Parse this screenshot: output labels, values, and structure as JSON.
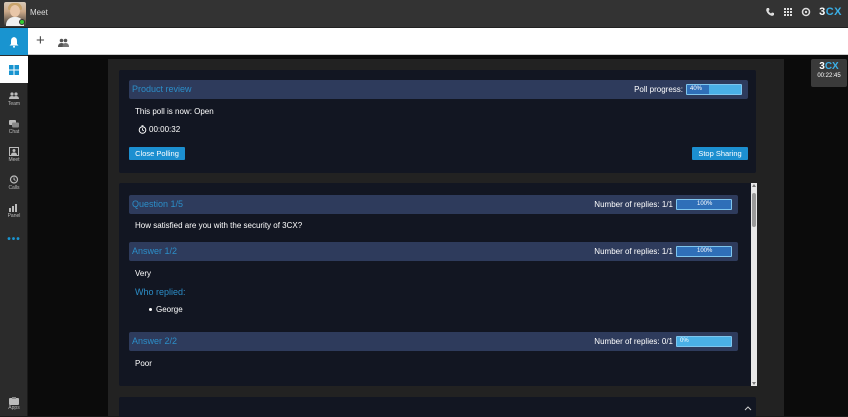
{
  "window": {
    "title": "Meet"
  },
  "brand": {
    "logo_prefix": "3",
    "logo_suffix": "CX",
    "accent": "#1994d0"
  },
  "sidebar": {
    "items": [
      {
        "label": "Team",
        "icon": "team-icon"
      },
      {
        "label": "Chat",
        "icon": "chat-icon"
      },
      {
        "label": "Meet",
        "icon": "meet-icon"
      },
      {
        "label": "Calls",
        "icon": "calls-icon"
      },
      {
        "label": "Panel",
        "icon": "panel-icon"
      }
    ],
    "more": "•••",
    "apps_label": "Apps"
  },
  "poll": {
    "title": "Product review",
    "progress_label": "Poll progress:",
    "progress_value": "40%",
    "progress_fraction": 0.4,
    "status_text": "This poll is now: Open",
    "timer": "00:00:32",
    "close_button": "Close Polling",
    "stop_button": "Stop Sharing"
  },
  "question": {
    "title": "Question 1/5",
    "replies_label": "Number of replies: 1/1",
    "replies_value": "100%",
    "replies_fraction": 1.0,
    "text": "How satisfied are you with the security of 3CX?"
  },
  "answers": [
    {
      "title": "Answer 1/2",
      "replies_label": "Number of replies: 1/1",
      "replies_value": "100%",
      "replies_fraction": 1.0,
      "text": "Very",
      "who_label": "Who replied:",
      "repliers": [
        "George"
      ]
    },
    {
      "title": "Answer 2/2",
      "replies_label": "Number of replies: 0/1",
      "replies_value": "0%",
      "replies_fraction": 0.0,
      "text": "Poor"
    }
  ],
  "mini_window": {
    "logo_prefix": "3",
    "logo_suffix": "CX",
    "time": "00:22:45"
  }
}
